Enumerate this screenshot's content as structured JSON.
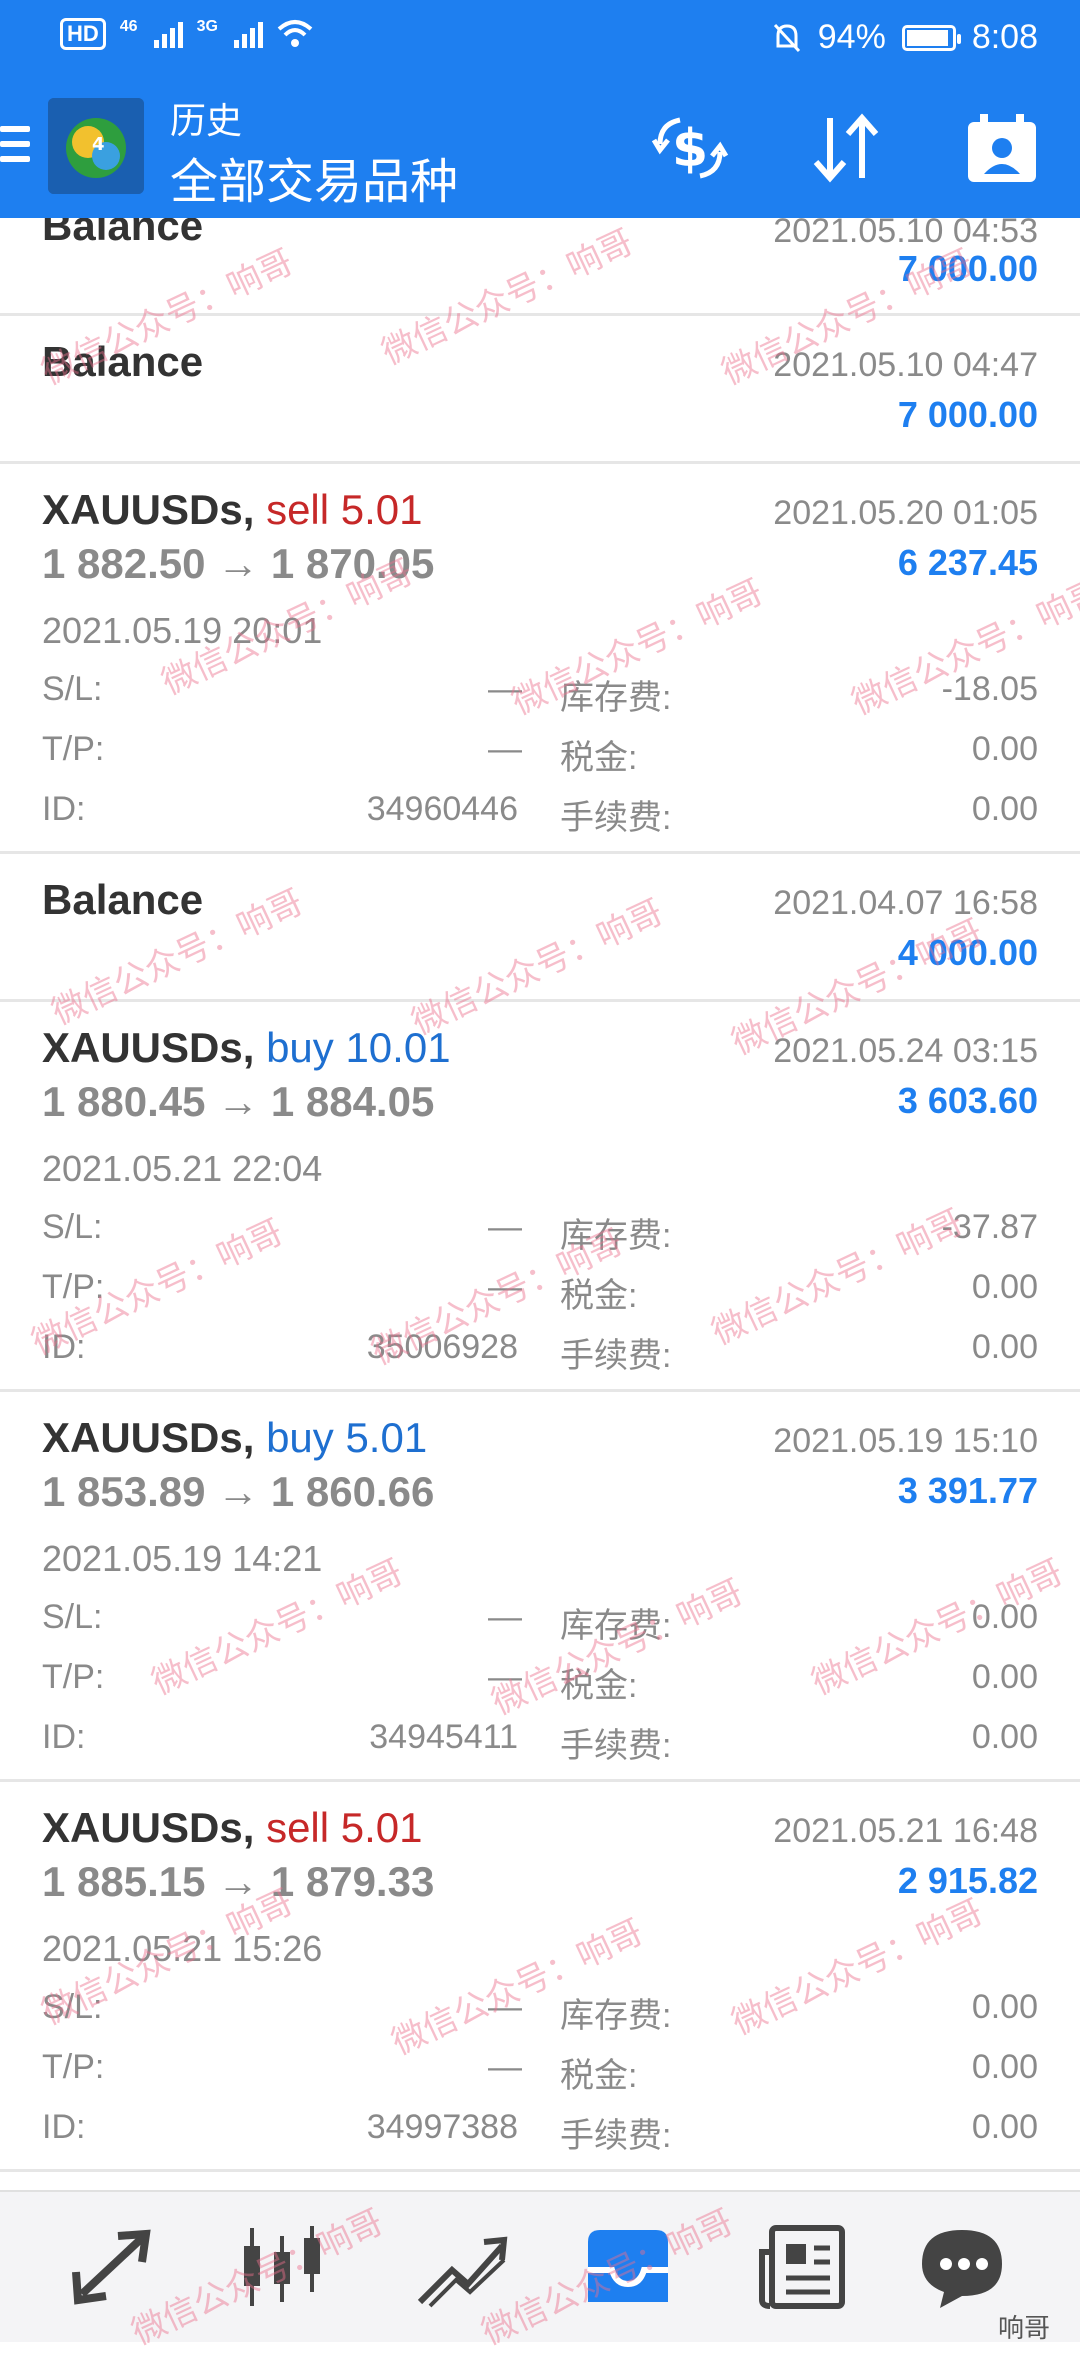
{
  "status": {
    "net1": "46",
    "net2": "3G",
    "battery": "94%",
    "battery_level": 0.94,
    "time": "8:08",
    "hd": "HD"
  },
  "header": {
    "title": "历史",
    "subtitle": "全部交易品种"
  },
  "rows": [
    {
      "kind": "balance",
      "label": "Balance",
      "date": "2021.05.10 04:53",
      "amount": "7 000.00"
    },
    {
      "kind": "balance",
      "label": "Balance",
      "date": "2021.05.10 04:47",
      "amount": "7 000.00"
    },
    {
      "kind": "trade",
      "symbol": "XAUUSDs,",
      "type": "sell 5.01",
      "prices": "1 882.50 → 1 870.05",
      "date": "2021.05.20 01:05",
      "amount": "6 237.45",
      "open_date": "2021.05.19 20:01",
      "sl": "—",
      "tp": "—",
      "id": "34960446",
      "swap": "-18.05",
      "tax": "0.00",
      "fee": "0.00"
    },
    {
      "kind": "balance",
      "label": "Balance",
      "date": "2021.04.07 16:58",
      "amount": "4 000.00"
    },
    {
      "kind": "trade",
      "symbol": "XAUUSDs,",
      "type": "buy 10.01",
      "prices": "1 880.45 → 1 884.05",
      "date": "2021.05.24 03:15",
      "amount": "3 603.60",
      "open_date": "2021.05.21 22:04",
      "sl": "—",
      "tp": "—",
      "id": "35006928",
      "swap": "-37.87",
      "tax": "0.00",
      "fee": "0.00"
    },
    {
      "kind": "trade",
      "symbol": "XAUUSDs,",
      "type": "buy 5.01",
      "prices": "1 853.89 → 1 860.66",
      "date": "2021.05.19 15:10",
      "amount": "3 391.77",
      "open_date": "2021.05.19 14:21",
      "sl": "—",
      "tp": "—",
      "id": "34945411",
      "swap": "0.00",
      "tax": "0.00",
      "fee": "0.00"
    },
    {
      "kind": "trade",
      "symbol": "XAUUSDs,",
      "type": "sell 5.01",
      "prices": "1 885.15 → 1 879.33",
      "date": "2021.05.21 16:48",
      "amount": "2 915.82",
      "open_date": "2021.05.21 15:26",
      "sl": "—",
      "tp": "—",
      "id": "34997388",
      "swap": "0.00",
      "tax": "0.00",
      "fee": "0.00"
    }
  ],
  "labels": {
    "sl": "S/L:",
    "tp": "T/P:",
    "id": "ID:",
    "swap": "库存费:",
    "tax": "税金:",
    "fee": "手续费:"
  },
  "nav": {
    "badge": "响哥",
    "icons": [
      "trade-arrows-icon",
      "candlestick-icon",
      "chart-line-icon",
      "history-inbox-icon",
      "news-icon",
      "chat-icon"
    ]
  },
  "watermark": {
    "text": "微信公众号：响哥"
  },
  "colors": {
    "header": "#1e7ff0",
    "sell": "#c62828",
    "buy": "#1e6fd0",
    "amount": "#1e7ff0"
  }
}
